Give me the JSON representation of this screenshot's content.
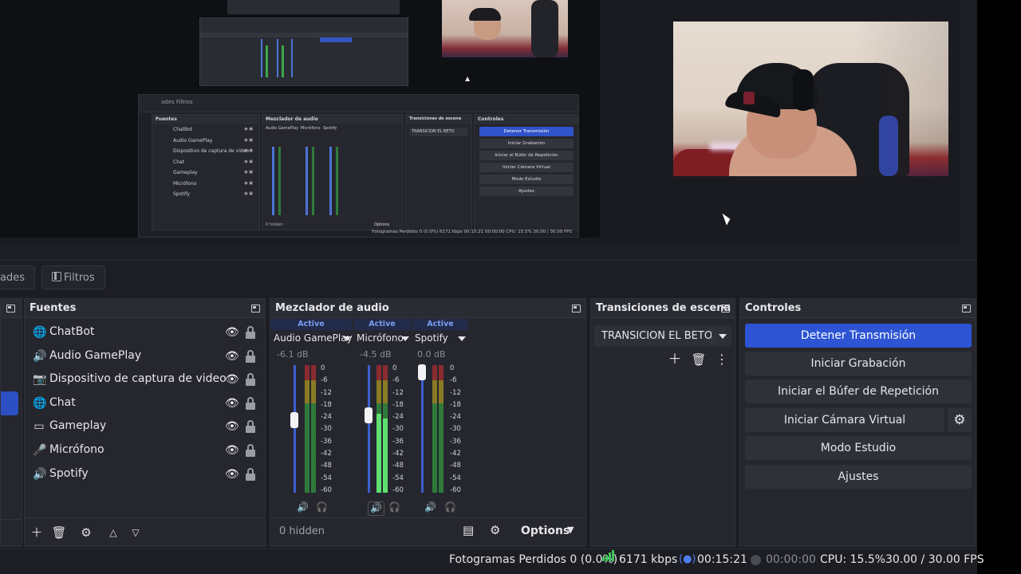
{
  "tabs": {
    "properties": "ades",
    "filters": "Filtros"
  },
  "sources": {
    "title": "Fuentes",
    "items": [
      {
        "label": "ChatBot",
        "icon": "browser-icon"
      },
      {
        "label": "Audio GamePlay",
        "icon": "speaker-icon"
      },
      {
        "label": "Dispositivo de captura de video",
        "icon": "camera-icon"
      },
      {
        "label": "Chat",
        "icon": "browser-icon"
      },
      {
        "label": "Gameplay",
        "icon": "display-icon"
      },
      {
        "label": "Micrófono",
        "icon": "microphone-icon"
      },
      {
        "label": "Spotify",
        "icon": "window-capture-icon"
      }
    ]
  },
  "mixer": {
    "title": "Mezclador de audio",
    "channels": [
      {
        "state": "Active",
        "name": "Audio GamePlay",
        "db": "-6.1 dB",
        "level": 0
      },
      {
        "state": "Active",
        "name": "Micrófono",
        "db": "-4.5 dB",
        "level": 0.62
      },
      {
        "state": "Active",
        "name": "Spotify",
        "db": "0.0 dB",
        "level": 0
      }
    ],
    "ticks": [
      "0",
      "-6",
      "-12",
      "-18",
      "-24",
      "-30",
      "-36",
      "-42",
      "-48",
      "-54",
      "-60"
    ],
    "hidden": "0 hidden",
    "options": "Options"
  },
  "transitions": {
    "title": "Transiciones de escena",
    "selected": "TRANSICION EL BETO"
  },
  "controls": {
    "title": "Controles",
    "stop_stream": "Detener Transmisión",
    "start_recording": "Iniciar Grabación",
    "start_replay": "Iniciar el Búfer de Repetición",
    "start_vcam": "Iniciar Cámara Virtual",
    "studio_mode": "Modo Estudio",
    "settings": "Ajustes"
  },
  "status": {
    "dropped": "Fotogramas Perdidos 0 (0.0%)",
    "bitrate": "6171 kbps",
    "stream_time": "00:15:21",
    "rec_time": "00:00:00",
    "cpu": "CPU: 15.5%",
    "fps": "30.00 / 30.00 FPS"
  },
  "nested": {
    "tabs": "ades    Filtros",
    "fuentes": "Fuentes",
    "mezclador": "Mezclador de audio",
    "transiciones": "Transiciones de escena",
    "controles": "Controles",
    "sources": [
      "ChatBot",
      "Audio GamePlay",
      "Dispositivo de captura de video",
      "Chat",
      "Gameplay",
      "Micrófono",
      "Spotify"
    ],
    "channels": [
      "Audio GamePlay",
      "Micrófono",
      "Spotify"
    ],
    "transition": "TRANSICION EL BETO",
    "buttons": [
      "Detener Transmisión",
      "Iniciar Grabación",
      "Iniciar el Búfer de Repetición",
      "Iniciar Cámara Virtual",
      "Modo Estudio",
      "Ajustes"
    ],
    "hidden": "0 hidden",
    "options": "Options",
    "status": "Fotogramas Perdidos 0 (0.0%)    6171 kbps    00:15:21    00:00:00    CPU: 15.5%    30.00 / 30.00 FPS"
  },
  "colors": {
    "accent": "#2d55d3",
    "meter_green": "#3fc65a",
    "panel": "#26272e",
    "background": "#1d1e24"
  }
}
